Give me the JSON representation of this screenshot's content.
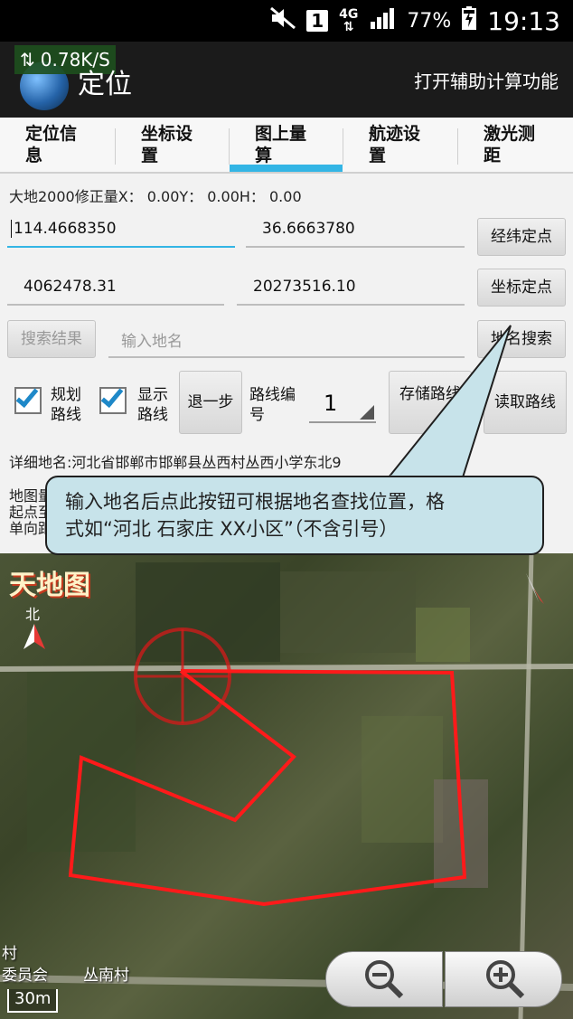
{
  "status_bar": {
    "network_type": "4G",
    "sim_slot": "1",
    "battery": "77%",
    "time": "19:13"
  },
  "action_bar": {
    "net_speed": "0.78K/S",
    "title": "定位",
    "assist_label": "打开辅助计算功能"
  },
  "tabs": [
    {
      "label_line1": "定位信",
      "label_line2": "息"
    },
    {
      "label_line1": "坐标设",
      "label_line2": "置"
    },
    {
      "label_line1": "图上量",
      "label_line2": "算",
      "selected": true
    },
    {
      "label_line1": "航迹设",
      "label_line2": "置"
    },
    {
      "label_line1": "激光测",
      "label_line2": "距"
    }
  ],
  "offset_text": "大地2000修正量X：  0.00Y：  0.00H：  0.00",
  "fields": {
    "longitude": "114.4668350",
    "latitude": "36.6663780",
    "coord_x": "4062478.31",
    "coord_y": "20273516.10",
    "place_placeholder": "输入地名"
  },
  "buttons": {
    "latlon_locate": "经纬定点",
    "coord_locate": "坐标定点",
    "search_results": "搜索结果",
    "place_search": "地名搜索",
    "back_step_line1": "退一",
    "back_step_line2": "步",
    "save_route": "存储路线",
    "load_route_line1": "读取路",
    "load_route_line2": "线"
  },
  "checkboxes": {
    "plan_route_line1": "规划",
    "plan_route_line2": "路线",
    "show_route_line1": "显示",
    "show_route_line2": "路线"
  },
  "route": {
    "label_line1": "路线编",
    "label_line2": "号",
    "value": "1"
  },
  "address": "详细地名:河北省邯郸市邯郸县丛西村丛西小学东北9",
  "map_info": {
    "line1": "地图量",
    "line2": "起点至",
    "line3": "单向距"
  },
  "callout": {
    "text_line1": "输入地名后点此按钮可根据地名查找位置，格",
    "text_line2": "式如“河北 石家庄 XX小区”（不含引号）"
  },
  "map": {
    "logo": "天地图",
    "north": "北",
    "village_label_1": "村",
    "village_label_2": "委员会",
    "village_label_3": "丛南村",
    "scale": "30m"
  },
  "colors": {
    "accent": "#33b5e5",
    "route_line": "#ff1a1a",
    "callout_bg": "#c7e3ea"
  }
}
